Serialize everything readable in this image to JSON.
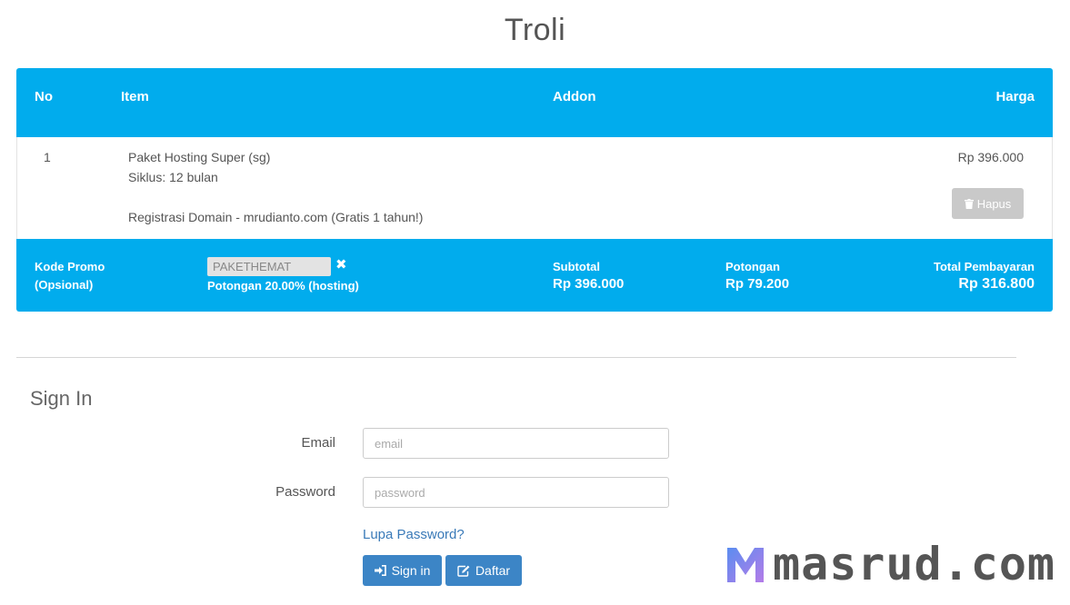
{
  "page": {
    "title": "Troli"
  },
  "cart": {
    "headers": {
      "no": "No",
      "item": "Item",
      "addon": "Addon",
      "harga": "Harga"
    },
    "items": [
      {
        "no": "1",
        "name": "Paket Hosting Super (sg)",
        "cycle": "Siklus: 12 bulan",
        "domain": "Registrasi Domain - mrudianto.com (Gratis 1 tahun!)",
        "price": "Rp 396.000",
        "remove_label": "Hapus",
        "remove_icon": "trash-icon"
      }
    ],
    "promo": {
      "label_line1": "Kode Promo",
      "label_line2": "(Opsional)",
      "code": "PAKETHEMAT",
      "remove_icon": "close-icon",
      "description": "Potongan 20.00% (hosting)"
    },
    "summary": {
      "subtotal_label": "Subtotal",
      "subtotal_value": "Rp 396.000",
      "discount_label": "Potongan",
      "discount_value": "Rp 79.200",
      "total_label": "Total Pembayaran",
      "total_value": "Rp 316.800"
    },
    "colors": {
      "header_bg": "#01aced"
    }
  },
  "signin": {
    "title": "Sign In",
    "email_label": "Email",
    "email_placeholder": "email",
    "email_value": "",
    "password_label": "Password",
    "password_placeholder": "password",
    "password_value": "",
    "forgot_link": "Lupa Password?",
    "signin_button": "Sign in",
    "signin_icon": "sign-in-icon",
    "register_button": "Daftar",
    "register_icon": "edit-icon",
    "button_color": "#3c85c6"
  },
  "watermark": {
    "text": "masrud.com",
    "logo": "m-logo"
  }
}
